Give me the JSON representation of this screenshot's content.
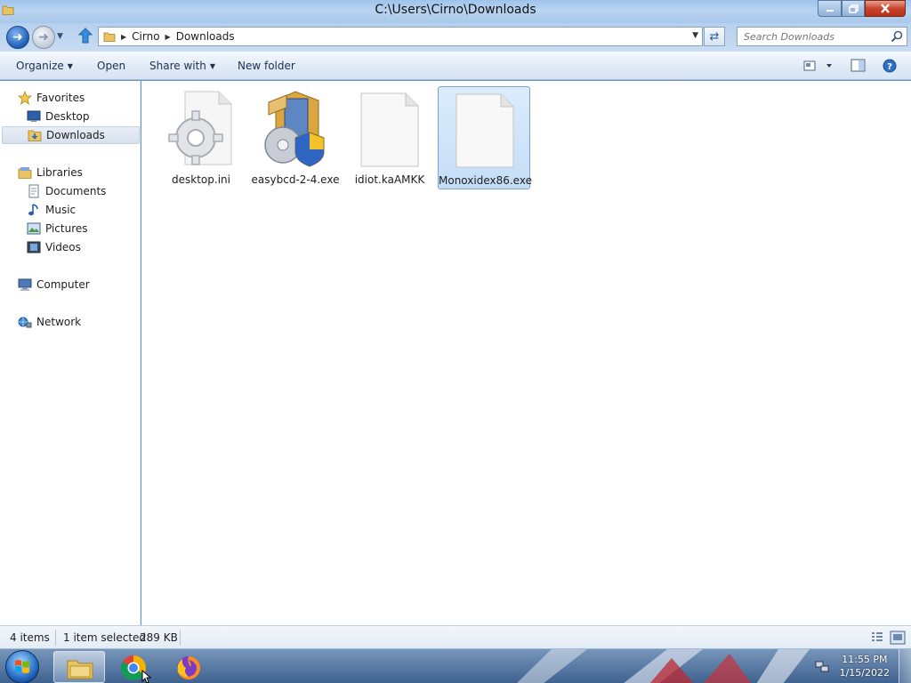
{
  "window": {
    "title": "C:\\Users\\Cirno\\Downloads",
    "minimize_icon": "minimize-icon",
    "maximize_icon": "maximize-icon",
    "close_icon": "close-icon"
  },
  "address_bar": {
    "breadcrumbs": [
      "Cirno",
      "Downloads"
    ],
    "search_placeholder": "Search Downloads"
  },
  "command_bar": {
    "organize": "Organize",
    "open": "Open",
    "share_with": "Share with",
    "new_folder": "New folder"
  },
  "nav_pane": {
    "favorites": {
      "label": "Favorites",
      "items": [
        {
          "label": "Desktop",
          "icon": "desktop-icon"
        },
        {
          "label": "Downloads",
          "icon": "downloads-folder-icon",
          "selected": true
        }
      ]
    },
    "libraries": {
      "label": "Libraries",
      "items": [
        {
          "label": "Documents",
          "icon": "documents-icon"
        },
        {
          "label": "Music",
          "icon": "music-icon"
        },
        {
          "label": "Pictures",
          "icon": "pictures-icon"
        },
        {
          "label": "Videos",
          "icon": "videos-icon"
        }
      ]
    },
    "computer": {
      "label": "Computer",
      "icon": "computer-icon"
    },
    "network": {
      "label": "Network",
      "icon": "network-icon"
    }
  },
  "files": [
    {
      "name": "desktop.ini",
      "icon": "settings-file-icon",
      "selected": false
    },
    {
      "name": "easybcd-2-4.exe",
      "icon": "installer-icon",
      "selected": false
    },
    {
      "name": "idiot.kaAMKK",
      "icon": "blank-file-icon",
      "selected": false
    },
    {
      "name": "Monoxidex86.exe",
      "icon": "blank-file-icon",
      "selected": true
    }
  ],
  "status_bar": {
    "item_count": "4 items",
    "selection": "1 item selected",
    "size": "289 KB"
  },
  "taskbar": {
    "apps": [
      "windows-explorer-icon",
      "chrome-icon",
      "firefox-icon"
    ],
    "time": "11:55 PM",
    "date": "1/15/2022"
  },
  "colors": {
    "selection_bg": "#cce0f8",
    "selection_border": "#7da2ce",
    "accent": "#2a73c8"
  }
}
